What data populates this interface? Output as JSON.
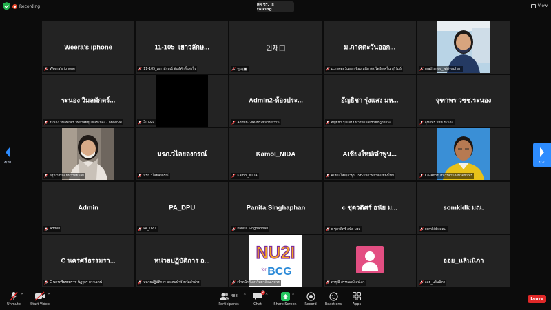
{
  "topbar": {
    "recording_label": "Recording",
    "talking_label": "ศศ ชร. is talking...",
    "view_label": "View"
  },
  "pager": {
    "left_page": "4/20",
    "right_page": "4/20"
  },
  "tiles": [
    {
      "name": "Weera's iphone",
      "label": "Weera's iphone"
    },
    {
      "name": "11-105_เยาวลักษ...",
      "label": "11-105_เยาวลักษณ์ พันธ์ศักดิ์แสงโร"
    },
    {
      "name": "인재口",
      "label": "인재🔲"
    },
    {
      "name": "ม.ภาคตะวันออก...",
      "label": "ม.ภาคตะวันออกเฉียงเหนือ ศศ.ไทยีเทคโน บุรีรัมย์"
    },
    {
      "name": "",
      "label": "mathanee_wiriyaphan"
    },
    {
      "name": "ระนอง วิมลพักตร์...",
      "label": "ระนอง วิมลพักตร์ วิทยาลัยชุมชนระนอง - observe"
    },
    {
      "name": "",
      "label": "Smbzc"
    },
    {
      "name": "Admin2-ห้องประ...",
      "label": "Admin2-ห้องประชุมวังเยาวน"
    },
    {
      "name": "อัญธิชา รุ่งแสง มห...",
      "label": "อัญธิชา รุ่งแสง มหาวิทยาลัยราชภัฏกำแพง"
    },
    {
      "name": "จุฑาพร วชช.ระนอง",
      "label": "จุฑาพร วชช.ระนอง"
    },
    {
      "name": "",
      "label": "อรุณวรรณ มหาวิทยาลัย"
    },
    {
      "name": "มรภ.วไลยลงกรณ์",
      "label": "มรภ.วไลยลงกรณ์"
    },
    {
      "name": "Kamol_NIDA",
      "label": "Kamol_NIDA"
    },
    {
      "name": "Aเชียงใหม่/ลำพูน...",
      "label": "Aเชียงใหม่/ลำพูน -SE-มหาวิทยาลัยเชียงใหม่"
    },
    {
      "name": "",
      "label": "Cองค์การบริหารส่วนจังหวัดชุมพร"
    },
    {
      "name": "Admin",
      "label": "Admin"
    },
    {
      "name": "PA_DPU",
      "label": "PA_DPU"
    },
    {
      "name": "Panita Singhaphan",
      "label": "Panita Singhaphan"
    },
    {
      "name": "c ชุตวดิศร์ อนัย ม...",
      "label": "c ชุตวดิศร์ อนัย มรล"
    },
    {
      "name": "somkidk มณ.",
      "label": "somkidk มณ."
    },
    {
      "name": "C นครศรีธรรมรา...",
      "label": "C นครศรีธรรมราช นิฏฐกร ยาวเจตน์"
    },
    {
      "name": "หน่วยปฏิบัติการ อ...",
      "label": "หน่วยปฏิบัติการ อวเศษน้ำจังหวัดลำปาง"
    },
    {
      "name": "",
      "label": "เจ้าหน้าที่มหาวิทยาลัยนเรศวร",
      "logo_main": "NU2I",
      "logo_sub": "BCG",
      "logo_for": "for"
    },
    {
      "name": "",
      "label": "ดารุณี สรรพพงษ์ สป.อว"
    },
    {
      "name": "ออย_นลินนิภา",
      "label": "ออย_นลินนิภา"
    }
  ],
  "toolbar": {
    "unmute": "Unmute",
    "start_video": "Start Video",
    "participants": "Participants",
    "participants_count": "488",
    "chat": "Chat",
    "chat_badge": "2",
    "share_screen": "Share Screen",
    "record": "Record",
    "reactions": "Reactions",
    "apps": "Apps",
    "leave": "Leave"
  },
  "colors": {
    "background": "#0c0c0c",
    "tile": "#232323",
    "accent_blue": "#2d8cff",
    "share_green": "#22c55e",
    "leave_red": "#e02828",
    "recording": "#e84a2f"
  }
}
